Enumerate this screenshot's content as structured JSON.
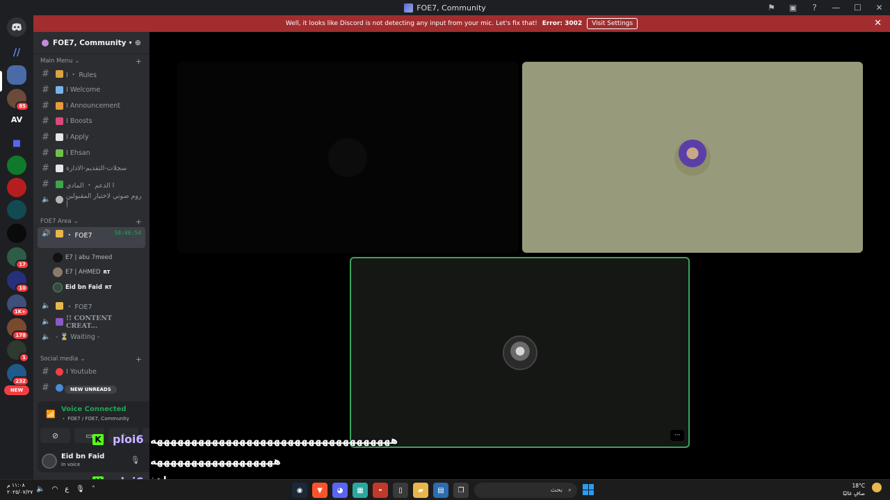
{
  "window": {
    "title": "FOE7, Community"
  },
  "banner": {
    "message": "Well, it looks like Discord is not detecting any input from your mic. Let's fix that!",
    "error": "Error: 3002",
    "button": "Visit Settings"
  },
  "rail": {
    "badges": [
      "85",
      "17",
      "10",
      "1K+",
      "178",
      "1",
      "232"
    ],
    "av_label": "AV",
    "new_label": "NEW"
  },
  "server": {
    "name": "FOE7, Community"
  },
  "categories": {
    "main": "Main Menu",
    "area": "FOE7 Area",
    "social": "Social media"
  },
  "channels": [
    {
      "label": "I ・ Rules"
    },
    {
      "label": "I Welcome"
    },
    {
      "label": "I Announcement"
    },
    {
      "label": "I Boosts"
    },
    {
      "label": "I Apply"
    },
    {
      "label": "I Ehsan"
    },
    {
      "label": "سجلات-التقديم-الادارة"
    },
    {
      "label": "الدعم ・ المادي I"
    },
    {
      "label": "روم صوتي لاختبار المقبولين |"
    }
  ],
  "voice_channels": {
    "active": {
      "label": "・ FOE7",
      "timer": "58:46:54"
    },
    "users": [
      {
        "name": "E7 | abu 7meed",
        "tag": ""
      },
      {
        "name": "E7 | AHMED",
        "tag": "RT"
      },
      {
        "name": "Eid bn Faid",
        "tag": "RT"
      }
    ],
    "others": [
      "・ FOE7",
      "!! CONTENT CREAT...",
      "- ⏳ Waiting -"
    ]
  },
  "social_channels": [
    {
      "label": "I Youtube"
    }
  ],
  "new_unreads": "NEW UNREADS",
  "voice_panel": {
    "status": "Voice Connected",
    "location": "・ FOE7 / FOE7, Community"
  },
  "user": {
    "name": "Eid bn Faid",
    "status": "In voice"
  },
  "overlay": {
    "line1": "هههههههههههههههههههههههههههههههههههه",
    "line2": "ههههههههههههههههههه",
    "kick_name": "ploi6",
    "kick_letter": "K",
    "arabic_tag": "اهخ"
  },
  "taskbar": {
    "time": "١١:٠٨ م",
    "date": "٢٠٢٥/٠٧/٢٧",
    "lang": "ع",
    "search": "بحث",
    "temperature": "18°C",
    "weather": "صافٍ غالبًا"
  },
  "colors": {
    "banner": "#a12d2f",
    "voice_green": "#23a559",
    "olive_tile": "#989a7c"
  }
}
